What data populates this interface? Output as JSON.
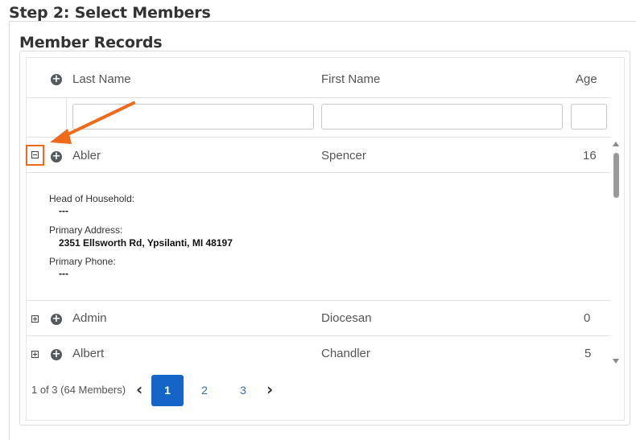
{
  "page": {
    "step_title": "Step 2: Select Members",
    "section_title": "Member Records"
  },
  "grid": {
    "columns": {
      "last_name": "Last Name",
      "first_name": "First Name",
      "age": "Age"
    },
    "filters": {
      "last_name": "",
      "first_name": "",
      "age": ""
    },
    "rows": [
      {
        "last_name": "Abler",
        "first_name": "Spencer",
        "age": "16",
        "expanded": true
      },
      {
        "last_name": "Admin",
        "first_name": "Diocesan",
        "age": "0",
        "expanded": false
      },
      {
        "last_name": "Albert",
        "first_name": "Chandler",
        "age": "5",
        "expanded": false
      }
    ],
    "detail": {
      "head_label": "Head of Household:",
      "head_value": "---",
      "address_label": "Primary Address:",
      "address_value": "2351 Ellsworth Rd, Ypsilanti, MI 48197",
      "phone_label": "Primary Phone:",
      "phone_value": "---"
    }
  },
  "pager": {
    "info": "1 of 3 (64 Members)",
    "prev": "‹",
    "next": "›",
    "pages": [
      "1",
      "2",
      "3"
    ],
    "current": "1"
  },
  "colors": {
    "highlight": "#f06a1a",
    "active_page": "#1565c8"
  },
  "icons": {
    "add": "plus-circle-icon",
    "expand": "expand-icon",
    "collapse": "collapse-icon"
  }
}
